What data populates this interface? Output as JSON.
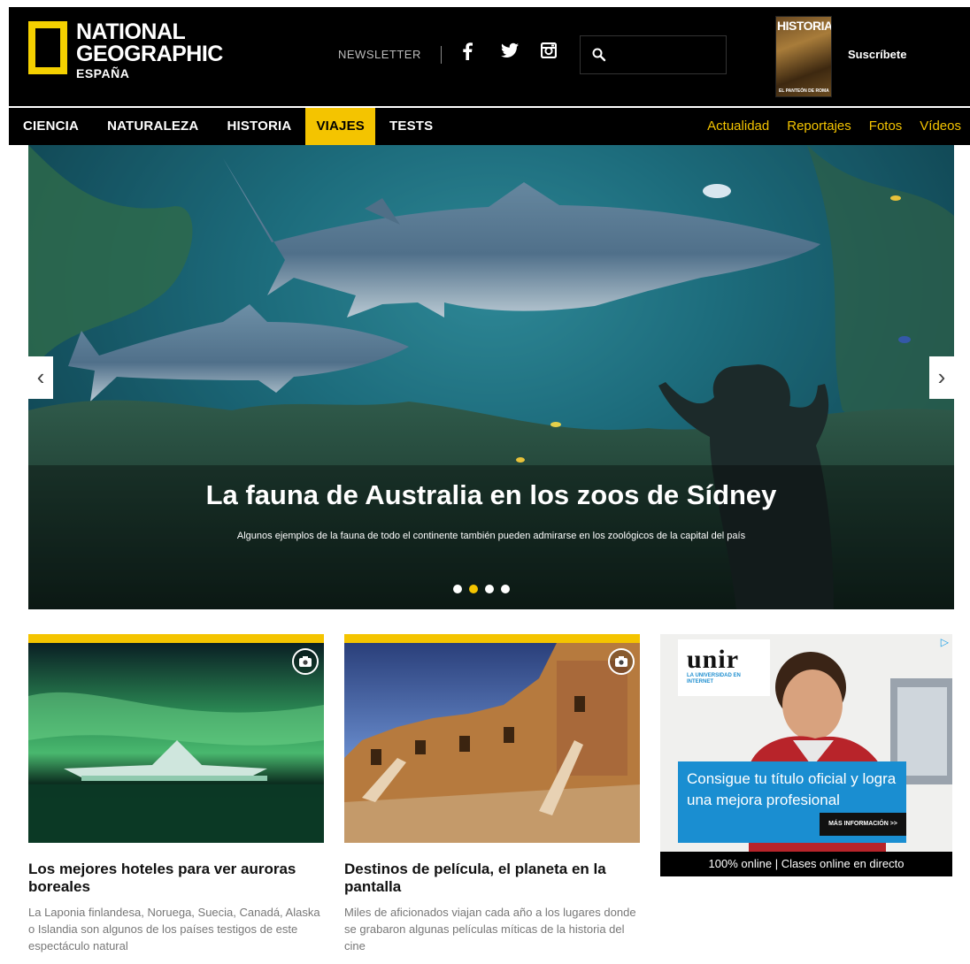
{
  "brand": {
    "line1": "NATIONAL",
    "line2": "GEOGRAPHIC",
    "line3": "ESPAÑA",
    "accent_color": "#f4c400"
  },
  "header": {
    "newsletter_label": "NEWSLETTER",
    "social": [
      "facebook-icon",
      "twitter-icon",
      "instagram-icon"
    ],
    "search": {
      "placeholder": ""
    },
    "magazine": {
      "title": "HISTORIA",
      "subtitle": "EL PANTEÓN DE ROMA"
    },
    "subscribe_label": "Suscríbete"
  },
  "nav": {
    "primary": [
      {
        "label": "CIENCIA",
        "active": false
      },
      {
        "label": "NATURALEZA",
        "active": false
      },
      {
        "label": "HISTORIA",
        "active": false
      },
      {
        "label": "VIAJES",
        "active": true
      },
      {
        "label": "TESTS",
        "active": false
      }
    ],
    "secondary": [
      "Actualidad",
      "Reportajes",
      "Fotos",
      "Vídeos"
    ]
  },
  "hero": {
    "title": "La fauna de Australia en los zoos de Sídney",
    "subtitle": "Algunos ejemplos de la fauna de todo el continente también pueden admirarse en los zoológicos de la capital del país",
    "slide_count": 4,
    "active_slide": 2,
    "prev_icon": "chevron-left-icon",
    "next_icon": "chevron-right-icon"
  },
  "cards": [
    {
      "title": "Los mejores hoteles para ver auroras boreales",
      "text": "La Laponia finlandesa, Noruega, Suecia, Canadá, Alaska o Islandia son algunos de los países testigos de este espectáculo natural",
      "icon": "camera-icon"
    },
    {
      "title": "Destinos de película, el planeta en la pantalla",
      "text": "Miles de aficionados viajan cada año a los lugares donde se grabaron algunas películas míticas de la historia del cine",
      "icon": "camera-icon"
    }
  ],
  "ad": {
    "logo": "unir",
    "logo_sub": "LA UNIVERSIDAD EN INTERNET",
    "headline": "Consigue tu título oficial y logra una mejora profesional",
    "cta": "MÁS INFORMACIÓN >>",
    "footer": "100% online | Clases online en directo"
  }
}
